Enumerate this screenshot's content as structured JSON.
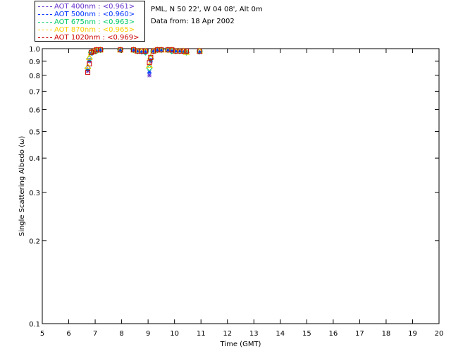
{
  "info": {
    "location": "PML, N 50 22', W 04 08', Alt 0m",
    "date": "Data from: 18 Apr 2002"
  },
  "chart_data": {
    "type": "scatter",
    "xlabel": "Time (GMT)",
    "ylabel": "Single Scattering Albedo (ω)",
    "xlim": [
      5,
      20
    ],
    "ylim": [
      0.1,
      1.0
    ],
    "yscale": "log",
    "grid": false,
    "legend_position": "top-left-outside",
    "x_ticks": [
      "5",
      "6",
      "7",
      "8",
      "9",
      "10",
      "11",
      "12",
      "13",
      "14",
      "15",
      "16",
      "17",
      "18",
      "19",
      "20"
    ],
    "y_ticks": [
      {
        "value": 1.0,
        "label": "1.0"
      },
      {
        "value": 0.9,
        "label": "0.9"
      },
      {
        "value": 0.8,
        "label": "0.8"
      },
      {
        "value": 0.7,
        "label": "0.7"
      },
      {
        "value": 0.6,
        "label": "0.6"
      },
      {
        "value": 0.5,
        "label": "0.5"
      },
      {
        "value": 0.4,
        "label": "0.4"
      },
      {
        "value": 0.3,
        "label": "0.3"
      },
      {
        "value": 0.2,
        "label": "0.2"
      },
      {
        "value": 0.1,
        "label": "0.1"
      }
    ],
    "x": [
      6.72,
      6.78,
      6.85,
      6.95,
      7.05,
      7.2,
      7.95,
      8.45,
      8.6,
      8.75,
      8.9,
      9.05,
      9.1,
      9.2,
      9.35,
      9.5,
      9.75,
      9.9,
      10.05,
      10.2,
      10.35,
      10.45,
      10.95
    ],
    "series": [
      {
        "name": "AOT  400nm : <0.961>",
        "color": "#6633cc",
        "marker": "star",
        "values": [
          0.83,
          0.9,
          0.96,
          0.97,
          0.98,
          0.99,
          0.99,
          0.99,
          0.98,
          0.97,
          0.97,
          0.8,
          0.9,
          0.98,
          0.99,
          0.99,
          0.99,
          0.98,
          0.98,
          0.98,
          0.97,
          0.97,
          0.97
        ]
      },
      {
        "name": "AOT  500nm : <0.960>",
        "color": "#0033ff",
        "marker": "star",
        "values": [
          0.84,
          0.91,
          0.96,
          0.97,
          0.98,
          0.99,
          0.99,
          0.99,
          0.98,
          0.97,
          0.97,
          0.82,
          0.91,
          0.98,
          0.99,
          0.99,
          0.99,
          0.98,
          0.98,
          0.98,
          0.97,
          0.97,
          0.97
        ]
      },
      {
        "name": "AOT  675nm : <0.963>",
        "color": "#00cc66",
        "marker": "diamond",
        "values": [
          0.85,
          0.92,
          0.97,
          0.98,
          0.98,
          0.99,
          0.99,
          0.99,
          0.98,
          0.98,
          0.97,
          0.85,
          0.92,
          0.98,
          0.99,
          0.99,
          0.99,
          0.98,
          0.98,
          0.98,
          0.98,
          0.97,
          0.98
        ]
      },
      {
        "name": "AOT  870nm : <0.965>",
        "color": "#ffcc00",
        "marker": "triangle",
        "values": [
          0.86,
          0.93,
          0.97,
          0.98,
          0.99,
          0.99,
          0.99,
          0.99,
          0.98,
          0.98,
          0.98,
          0.87,
          0.93,
          0.98,
          0.99,
          0.99,
          0.99,
          0.99,
          0.98,
          0.98,
          0.98,
          0.97,
          0.98
        ]
      },
      {
        "name": "AOT 1020nm : <0.969>",
        "color": "#cc0000",
        "marker": "square",
        "values": [
          0.82,
          0.88,
          0.97,
          0.98,
          0.99,
          0.99,
          0.99,
          0.99,
          0.98,
          0.98,
          0.98,
          0.89,
          0.93,
          0.98,
          0.99,
          0.99,
          0.99,
          0.99,
          0.98,
          0.98,
          0.98,
          0.98,
          0.98
        ]
      }
    ]
  }
}
